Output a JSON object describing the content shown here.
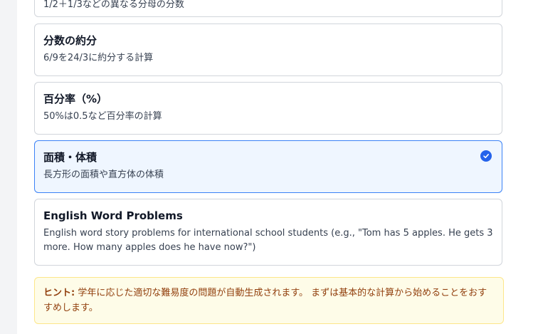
{
  "options": [
    {
      "title": "",
      "desc": "1/2＋1/3などの異なる分母の分数",
      "selected": false
    },
    {
      "title": "分数の約分",
      "desc": "6/9を24/3に約分する計算",
      "selected": false
    },
    {
      "title": "百分率（%）",
      "desc": "50%は0.5など百分率の計算",
      "selected": false
    },
    {
      "title": "面積・体積",
      "desc": "長方形の面積や直方体の体積",
      "selected": true
    },
    {
      "title": "English Word Problems",
      "desc": "English word story problems for international school students (e.g., \"Tom has 5 apples. He gets 3 more. How many apples does he have now?\")",
      "selected": false
    }
  ],
  "hint": {
    "label": "ヒント:",
    "text": "学年に応じた適切な難易度の問題が自動生成されます。 まずは基本的な計算から始めることをおすすめします。"
  },
  "icons": {
    "selected": "check-circle-icon"
  },
  "colors": {
    "accent": "#2563eb",
    "hint_text": "#92400e"
  }
}
